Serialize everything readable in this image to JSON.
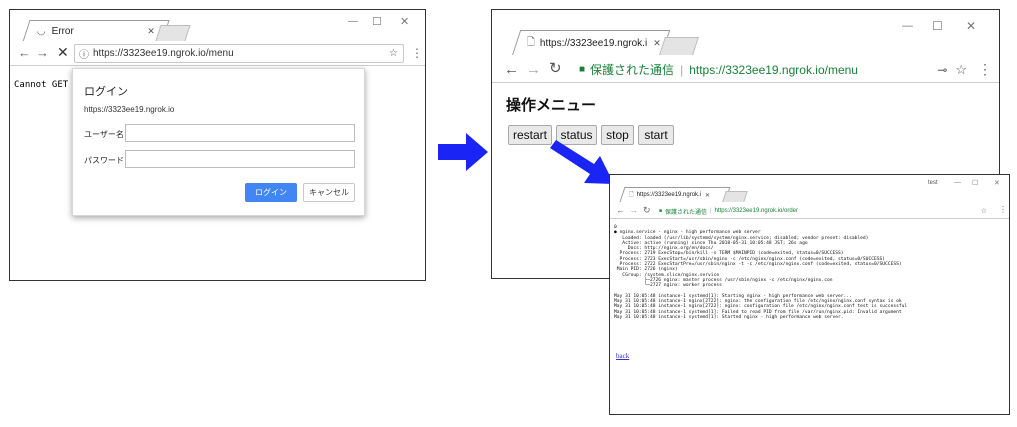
{
  "window1": {
    "tab_title": "Error",
    "address": "https://3323ee19.ngrok.io/menu",
    "page_text": "Cannot GET /",
    "login_dialog": {
      "title": "ログイン",
      "origin": "https://3323ee19.ngrok.io",
      "username_label": "ユーザー名",
      "password_label": "パスワード",
      "login_button": "ログイン",
      "cancel_button": "キャンセル"
    }
  },
  "window2": {
    "tab_title": "https://3323ee19.ngrok.i",
    "secure_label": "保護された通信",
    "address": "https://3323ee19.ngrok.io/menu",
    "heading": "操作メニュー",
    "buttons": [
      "restart",
      "status",
      "stop",
      "start"
    ]
  },
  "window3": {
    "tab_title": "https://3323ee19.ngrok.i",
    "profile_label": "test",
    "secure_label": "保護された通信",
    "address": "https://3323ee19.ngrok.io/order",
    "output_lines": [
      "0",
      "● nginx.service - nginx - high performance web server",
      "   Loaded: loaded (/usr/lib/systemd/system/nginx.service; disabled; vendor preset: disabled)",
      "   Active: active (running) since Thu 2018-05-31 10:05:48 JST; 26s ago",
      "     Docs: http://nginx.org/en/docs/",
      "  Process: 2719 ExecStop=/bin/kill -s TERM $MAINPID (code=exited, status=0/SUCCESS)",
      "  Process: 2723 ExecStart=/usr/sbin/nginx -c /etc/nginx/nginx.conf (code=exited, status=0/SUCCESS)",
      "  Process: 2722 ExecStartPre=/usr/sbin/nginx -t -c /etc/nginx/nginx.conf (code=exited, status=0/SUCCESS)",
      " Main PID: 2726 (nginx)",
      "   CGroup: /system.slice/nginx.service",
      "           ├─2726 nginx: master process /usr/sbin/nginx -c /etc/nginx/nginx.con",
      "           └─2727 nginx: worker process",
      "",
      "May 31 10:05:48 instance-1 systemd[1]: Starting nginx - high performance web server...",
      "May 31 10:05:48 instance-1 nginx[2722]: nginx: the configuration file /etc/nginx/nginx.conf syntax is ok",
      "May 31 10:05:48 instance-1 nginx[2722]: nginx: configuration file /etc/nginx/nginx.conf test is successful",
      "May 31 10:05:48 instance-1 systemd[1]: Failed to read PID from file /var/run/nginx.pid: Invalid argument",
      "May 31 10:05:48 instance-1 systemd[1]: Started nginx - high performance web server."
    ],
    "back_link": "back"
  },
  "icons": {
    "reload": "↻",
    "stop": "✕",
    "back": "←",
    "forward": "→",
    "info": "ⓘ",
    "lock": "🔒",
    "star": "☆",
    "menu": "⋮",
    "key": "⊸",
    "minimize": "—",
    "maximize": "☐",
    "close": "✕"
  },
  "colors": {
    "arrow_blue": "#1a24f5",
    "login_button_blue": "#4285f4",
    "secure_green": "#188038"
  }
}
